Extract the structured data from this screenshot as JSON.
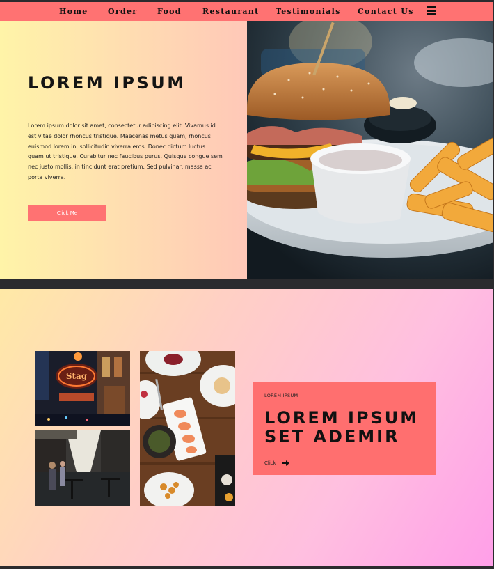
{
  "nav": {
    "items": [
      {
        "label": "Home",
        "key": "home"
      },
      {
        "label": "Order",
        "key": "order"
      },
      {
        "label": "Food",
        "key": "food"
      },
      {
        "label": "Restaurant",
        "key": "restaurant"
      },
      {
        "label": "Testimonials",
        "key": "testimonials"
      },
      {
        "label": "Contact Us",
        "key": "contact-us"
      }
    ],
    "menu_icon": "hamburger-menu-icon"
  },
  "hero": {
    "title": "LOREM IPSUM",
    "paragraph": "Lorem ipsum dolor sit amet, consectetur adipiscing elit. Vivamus id est vitae dolor rhoncus tristique. Maecenas metus quam, rhoncus euismod lorem in, sollicitudin viverra eros. Donec dictum luctus quam ut tristique. Curabitur nec faucibus purus. Quisque congue sem nec justo mollis, in tincidunt erat pretium. Sed pulvinar, massa ac porta viverra.",
    "button_label": "Click Me",
    "image": "burger-and-fries-photo"
  },
  "gallery": {
    "images": [
      "pub-neon-sign-photo",
      "street-cafe-alley-photo",
      "food-table-overhead-photo"
    ]
  },
  "card": {
    "kicker": "LOREM IPSUM",
    "title_line1": "LOREM IPSUM",
    "title_line2": "SET ADEMIR",
    "click_label": "Click",
    "arrow_icon": "arrow-right-icon"
  },
  "colors": {
    "accent": "#ff7272",
    "frame": "#2b2b2e"
  }
}
